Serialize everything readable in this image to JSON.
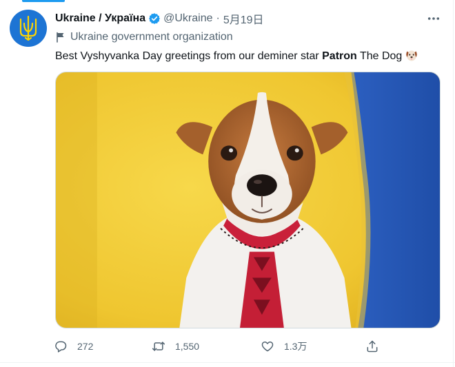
{
  "tweet": {
    "display_name": "Ukraine / Україна",
    "handle": "@Ukraine",
    "separator": "·",
    "date": "5月19日",
    "affiliation": "Ukraine government organization",
    "text_before": "Best Vyshyvanka Day greetings from our deminer star ",
    "text_bold": "Patron",
    "text_after": " The Dog",
    "emoji": "dog-face",
    "media_subject": "dog",
    "colors": {
      "accent": "#1d9bf0",
      "avatar_bg": "#1d74d4",
      "trident": "#ffd500",
      "muted": "#536471"
    }
  },
  "actions": {
    "reply_count": "272",
    "retweet_count": "1,550",
    "like_count": "1.3万",
    "share_icon": "share-icon"
  }
}
